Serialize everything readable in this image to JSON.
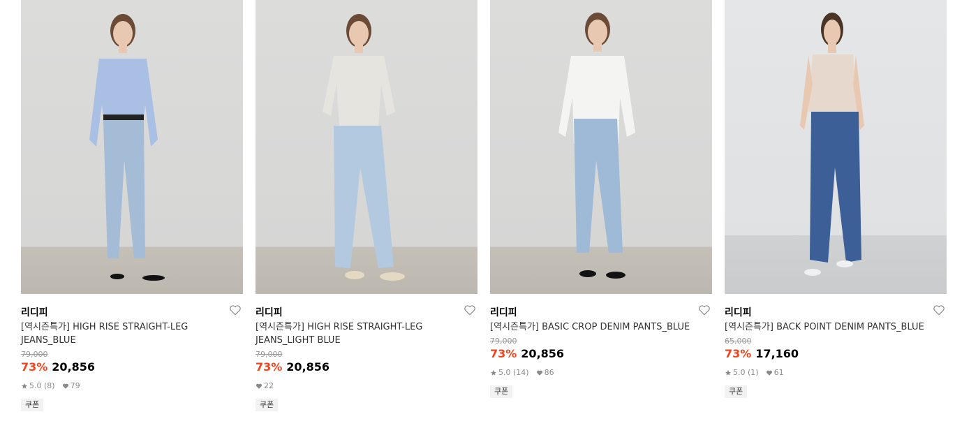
{
  "products": [
    {
      "brand": "리디피",
      "title": "[역시즌특가] HIGH RISE STRAIGHT-LEG JEANS_BLUE",
      "original_price": "79,000",
      "discount": "73%",
      "price": "20,856",
      "rating": "5.0 (8)",
      "likes": "79",
      "badge": "쿠폰"
    },
    {
      "brand": "리디피",
      "title": "[역시즌특가] HIGH RISE STRAIGHT-LEG JEANS_LIGHT BLUE",
      "original_price": "79,000",
      "discount": "73%",
      "price": "20,856",
      "likes": "22",
      "badge": "쿠폰"
    },
    {
      "brand": "리디피",
      "title": "[역시즌특가] BASIC CROP DENIM PANTS_BLUE",
      "original_price": "79,000",
      "discount": "73%",
      "price": "20,856",
      "rating": "5.0 (14)",
      "likes": "86",
      "badge": "쿠폰"
    },
    {
      "brand": "리디피",
      "title": "[역시즌특가] BACK POINT DENIM PANTS_BLUE",
      "original_price": "65,000",
      "discount": "73%",
      "price": "17,160",
      "rating": "5.0 (1)",
      "likes": "61",
      "badge": "쿠폰"
    }
  ],
  "colors": {
    "discount": "#f0441d",
    "strike": "#999999",
    "meta": "#8a8a8a"
  },
  "icons": {
    "like": "heart-outline-icon",
    "rating": "star-icon",
    "likes": "heart-icon"
  }
}
